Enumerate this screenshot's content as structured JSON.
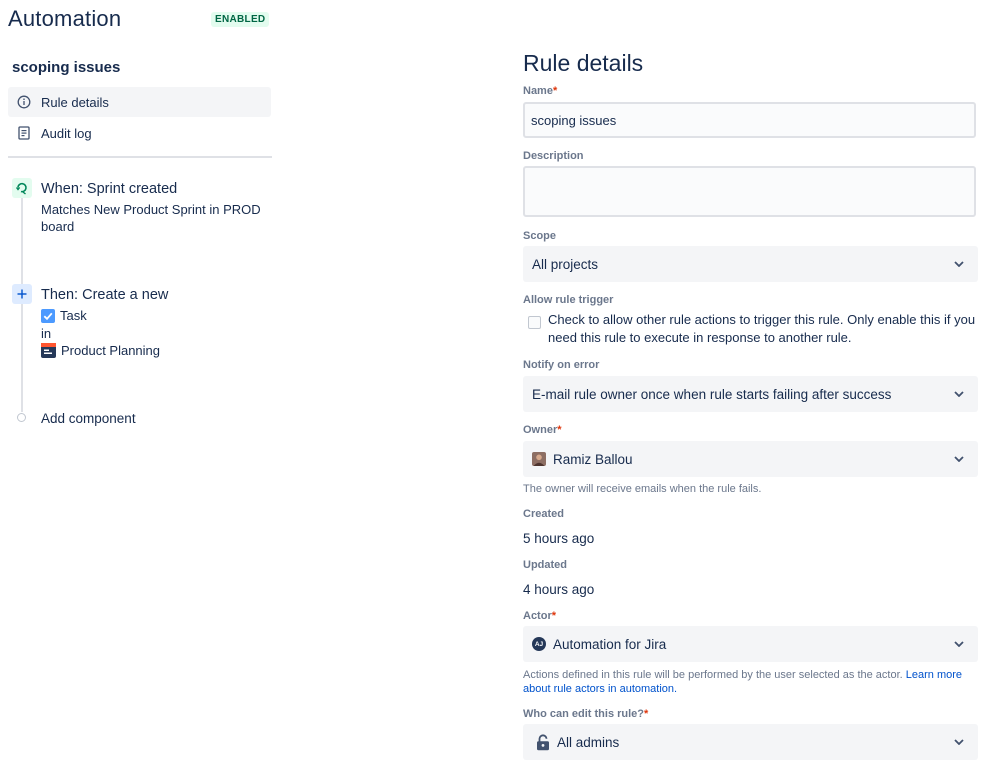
{
  "header": {
    "title": "Automation",
    "status_badge": "ENABLED"
  },
  "sidebar": {
    "rule_name": "scoping issues",
    "nav": [
      {
        "label": "Rule details",
        "icon": "info-icon",
        "active": true
      },
      {
        "label": "Audit log",
        "icon": "document-icon",
        "active": false
      }
    ],
    "components": {
      "trigger": {
        "title": "When: Sprint created",
        "description": "Matches New Product Sprint in PROD board",
        "icon": "trigger-icon"
      },
      "action": {
        "title": "Then: Create a new",
        "issue_type": "Task",
        "connector": "in",
        "project": "Product Planning",
        "icon": "plus-icon"
      },
      "add_component": "Add component"
    }
  },
  "details": {
    "title": "Rule details",
    "name": {
      "label": "Name",
      "required_mark": "*",
      "value": "scoping issues"
    },
    "description": {
      "label": "Description",
      "value": ""
    },
    "scope": {
      "label": "Scope",
      "value": "All projects"
    },
    "allow_trigger": {
      "label": "Allow rule trigger",
      "checkbox_text": "Check to allow other rule actions to trigger this rule. Only enable this if you need this rule to execute in response to another rule.",
      "checked": false
    },
    "notify": {
      "label": "Notify on error",
      "value": "E-mail rule owner once when rule starts failing after success"
    },
    "owner": {
      "label": "Owner",
      "required_mark": "*",
      "value": "Ramiz Ballou",
      "helper": "The owner will receive emails when the rule fails."
    },
    "created": {
      "label": "Created",
      "value": "5 hours ago"
    },
    "updated": {
      "label": "Updated",
      "value": "4 hours ago"
    },
    "actor": {
      "label": "Actor",
      "required_mark": "*",
      "value": "Automation for Jira",
      "avatar_initials": "AJ",
      "helper": "Actions defined in this rule will be performed by the user selected as the actor.",
      "helper_link": "Learn more about rule actors in automation."
    },
    "editors": {
      "label": "Who can edit this rule?",
      "required_mark": "*",
      "value": "All admins"
    }
  },
  "colors": {
    "text": "#172b4d",
    "subtle_text": "#6b778c",
    "link": "#0052cc",
    "required": "#de350b",
    "badge_bg": "#e3fcef",
    "badge_text": "#006644",
    "field_bg": "#f4f5f7",
    "trigger_green": "#00875a",
    "action_blue": "#0052cc",
    "task_blue": "#4c9aff"
  }
}
